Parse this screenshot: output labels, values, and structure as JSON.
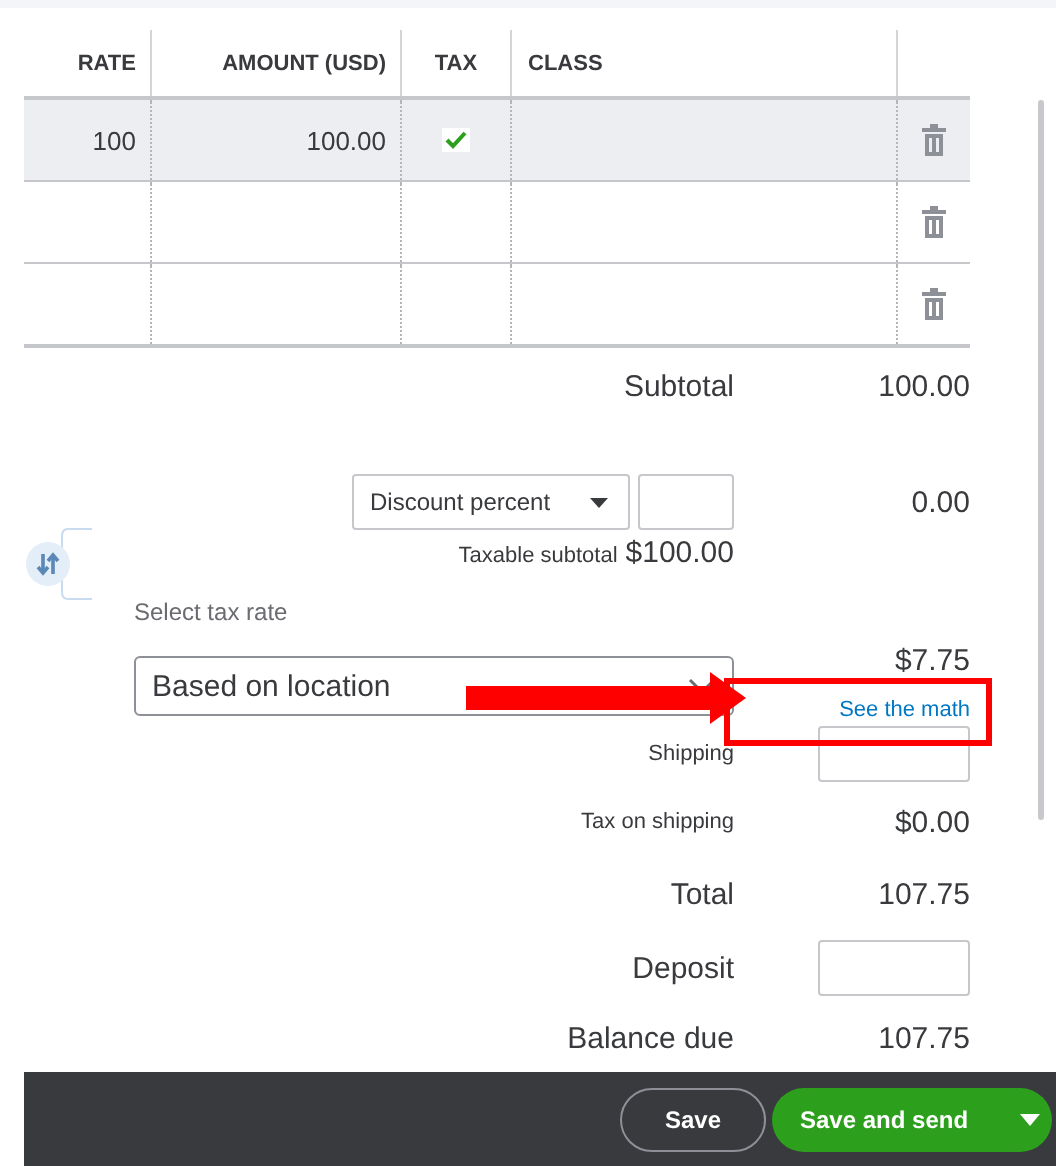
{
  "table": {
    "columns": [
      "RATE",
      "AMOUNT (USD)",
      "TAX",
      "CLASS"
    ],
    "rows": [
      {
        "rate": "100",
        "amount": "100.00",
        "taxable": true,
        "selected": true
      },
      {
        "taxable": false,
        "selected": false
      },
      {
        "taxable": false,
        "selected": false
      }
    ]
  },
  "summary": {
    "subtotal": {
      "label": "Subtotal",
      "value": "100.00"
    },
    "discount": {
      "type": "Discount percent",
      "value": "0.00"
    },
    "taxable_subtotal": {
      "label": "Taxable subtotal",
      "value": "$100.00"
    },
    "tax_rate": {
      "label": "Select tax rate",
      "value": "Based on location",
      "amount": "$7.75",
      "link": "See the math"
    },
    "shipping": {
      "label": "Shipping"
    },
    "tax_on_shipping": {
      "label": "Tax on shipping",
      "value": "$0.00"
    },
    "total": {
      "label": "Total",
      "value": "107.75"
    },
    "deposit": {
      "label": "Deposit"
    },
    "balance_due": {
      "label": "Balance due",
      "value": "107.75"
    }
  },
  "footer": {
    "save": "Save",
    "save_and_send": "Save and send"
  },
  "annotation": {
    "kind": "arrow-and-box"
  }
}
